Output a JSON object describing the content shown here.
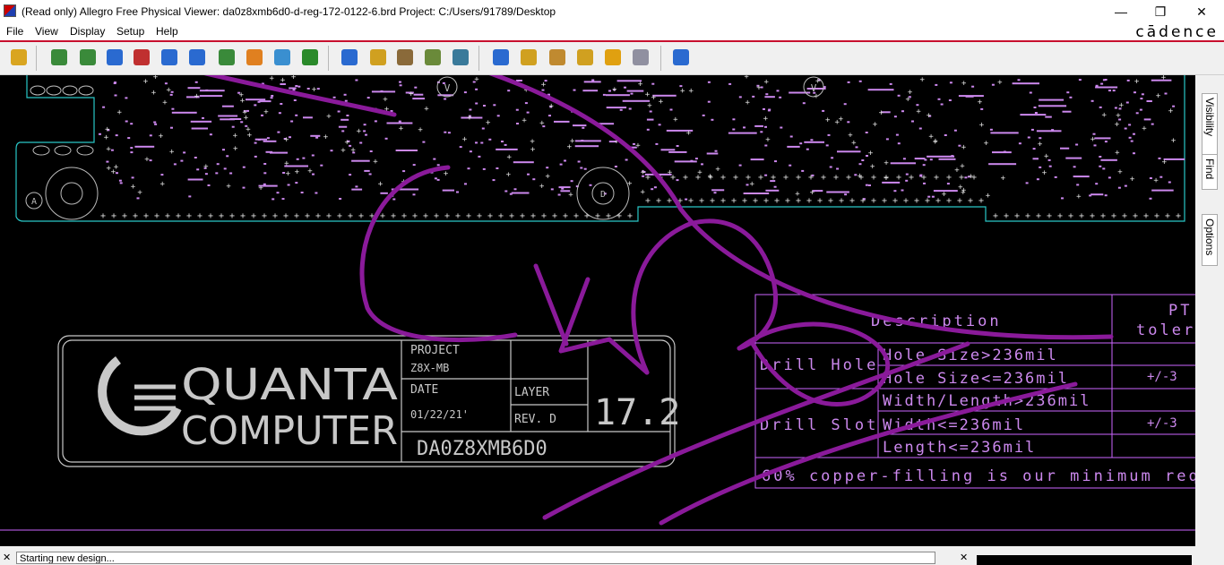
{
  "window": {
    "title": "(Read only) Allegro Free Physical Viewer: da0z8xmb6d0-d-reg-172-0122-6.brd  Project: C:/Users/91789/Desktop",
    "controls": {
      "minimize": "—",
      "maximize": "❐",
      "close": "✕"
    }
  },
  "menu": {
    "items": [
      "File",
      "View",
      "Display",
      "Setup",
      "Help"
    ],
    "brand": "cādence"
  },
  "toolbar": {
    "buttons": [
      {
        "name": "open-icon",
        "color": "#d9a520"
      },
      {
        "name": "zoom-fit-icon",
        "color": "#3a8a3a"
      },
      {
        "name": "zoom-world-icon",
        "color": "#3a8a3a"
      },
      {
        "name": "zoom-points-icon",
        "color": "#2a6ad0"
      },
      {
        "name": "zoom-window-icon",
        "color": "#c03030"
      },
      {
        "name": "zoom-in-icon",
        "color": "#2a6ad0"
      },
      {
        "name": "zoom-out-icon",
        "color": "#2a6ad0"
      },
      {
        "name": "zoom-previous-icon",
        "color": "#3a8a3a"
      },
      {
        "name": "redraw-icon",
        "color": "#e08020"
      },
      {
        "name": "view-3d-icon",
        "color": "#3a8fd0"
      },
      {
        "name": "flip-board-icon",
        "color": "#2a8a2a"
      },
      {
        "name": "grid-icon",
        "color": "#2a6ad0"
      },
      {
        "name": "color-layers-icon",
        "color": "#d0a020"
      },
      {
        "name": "shadow-mode-icon",
        "color": "#8a6a3a"
      },
      {
        "name": "layer-stack-icon",
        "color": "#6a8a3a"
      },
      {
        "name": "constraint-manager-icon",
        "color": "#3a7a9a"
      },
      {
        "name": "info-icon",
        "color": "#2a6ad0"
      },
      {
        "name": "report-icon",
        "color": "#d0a020"
      },
      {
        "name": "measure-icon",
        "color": "#c08a30"
      },
      {
        "name": "highlight-brush-icon",
        "color": "#d0a020"
      },
      {
        "name": "brightness-sun-icon",
        "color": "#e0a010"
      },
      {
        "name": "dehighlight-icon",
        "color": "#9090a0"
      },
      {
        "name": "help-icon",
        "color": "#2a6ad0"
      }
    ]
  },
  "sidepanel": {
    "tabs": [
      "Visibility",
      "Find",
      "Options"
    ]
  },
  "board": {
    "titleblock": {
      "company_line1": "QUANTA",
      "company_line2": "COMPUTER",
      "project_label": "PROJECT",
      "project_value": "Z8X-MB",
      "date_label": "DATE",
      "date_value": "01/22/21'",
      "layer_label": "LAYER",
      "rev_label": "REV. D",
      "version": "17.2",
      "part_number": "DA0Z8XMB6D0"
    },
    "drill_table": {
      "col_description": "Description",
      "col_pt": "PT",
      "col_tolerance": "toler",
      "row1_label": "Drill Hole",
      "row1a": "Hole Size>236mil",
      "row1b": "Hole Size<=236mil",
      "row1b_tol": "+/-3",
      "row2_label": "Drill Slot",
      "row2a": "Width/Length>236mil",
      "row2b": "Width<=236mil",
      "row2b_tol": "+/-3",
      "row2c": "Length<=236mil",
      "footnote": "60% copper-filling is our minimum req"
    },
    "via_markers": [
      "V",
      "V",
      "A",
      "D"
    ],
    "colors": {
      "outline": "#29c7c7",
      "component": "#cc88ee",
      "titleblock": "#c8c8c8",
      "table": "#cc66ff",
      "annotation": "#8a1a9a"
    }
  },
  "status": {
    "message": "Starting new design...",
    "close1": "✕",
    "close2": "✕"
  }
}
